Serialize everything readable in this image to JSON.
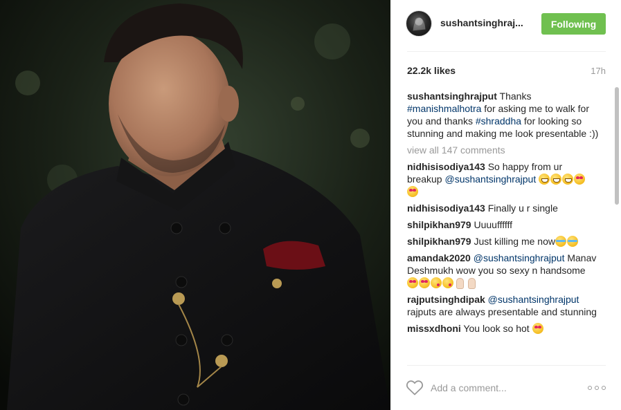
{
  "post": {
    "username": "sushantsinghraj...",
    "follow_label": "Following",
    "likes": "22.2k likes",
    "time": "17h",
    "caption": {
      "username": "sushantsinghrajput",
      "text_1": " Thanks ",
      "tag_1": "#manishmalhotra",
      "text_2": " for asking me to walk for you and thanks ",
      "tag_2": "#shraddha",
      "text_3": " for looking so stunning and making me look presentable :))"
    },
    "view_all": "view all 147 comments"
  },
  "comments": [
    {
      "username": "nidhisisodiya143",
      "text": " So happy from ur breakup ",
      "mention": "@sushantsinghrajput",
      "text_after": " "
    },
    {
      "username": "nidhisisodiya143",
      "text": " Finally u r single"
    },
    {
      "username": "shilpikhan979",
      "text": " Uuuuffffff"
    },
    {
      "username": "shilpikhan979",
      "text": " Just killing me now"
    },
    {
      "username": "amandak2020",
      "mention": " @sushantsinghrajput",
      "text": " Manav Deshmukh wow you so sexy n handsome "
    },
    {
      "username": "rajputsinghdipak",
      "mention": " @sushantsinghrajput",
      "text": " rajputs are always presentable and stunning"
    },
    {
      "username": "missxdhoni",
      "text": " You look so hot "
    }
  ],
  "comment_bar": {
    "placeholder": "Add a comment..."
  },
  "icons": {
    "like": "heart-outline-icon",
    "more": "more-options-icon"
  },
  "colors": {
    "follow_button": "#70c050",
    "hashtag": "#003569",
    "muted": "#999999"
  }
}
